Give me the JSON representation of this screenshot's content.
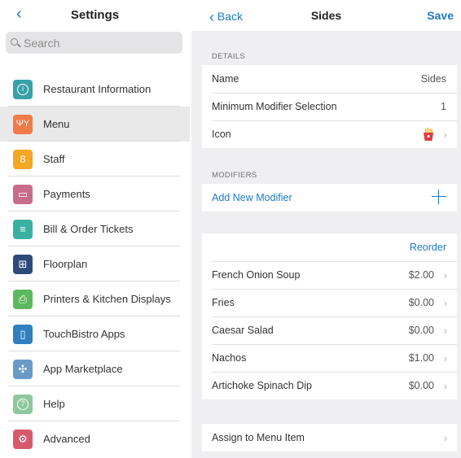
{
  "left": {
    "back_glyph": "‹",
    "title": "Settings",
    "search_placeholder": "Search",
    "items": [
      {
        "label": "Restaurant Information",
        "icon": "info-icon",
        "glyph": "i",
        "color": "#3aa0a8"
      },
      {
        "label": "Menu",
        "icon": "fork-knife-icon",
        "glyph": "ΨΥ",
        "color": "#f07a4a",
        "selected": true
      },
      {
        "label": "Staff",
        "icon": "person-icon",
        "glyph": "8",
        "color": "#f5a623"
      },
      {
        "label": "Payments",
        "icon": "card-icon",
        "glyph": "▭",
        "color": "#c96b8a"
      },
      {
        "label": "Bill & Order Tickets",
        "icon": "receipt-icon",
        "glyph": "≡",
        "color": "#3ab0a0"
      },
      {
        "label": "Floorplan",
        "icon": "floorplan-icon",
        "glyph": "⊞",
        "color": "#2c4a7a"
      },
      {
        "label": "Printers & Kitchen Displays",
        "icon": "printer-icon",
        "glyph": "⎙",
        "color": "#5cb85c"
      },
      {
        "label": "TouchBistro Apps",
        "icon": "tablet-icon",
        "glyph": "▯",
        "color": "#2f7fc1"
      },
      {
        "label": "App Marketplace",
        "icon": "puzzle-icon",
        "glyph": "✣",
        "color": "#6a9ac8"
      },
      {
        "label": "Help",
        "icon": "help-icon",
        "glyph": "?",
        "color": "#8dc89a"
      },
      {
        "label": "Advanced",
        "icon": "gear-icon",
        "glyph": "⚙",
        "color": "#d65a6a"
      }
    ]
  },
  "right": {
    "back_label": "Back",
    "title": "Sides",
    "save_label": "Save",
    "details_header": "DETAILS",
    "details": {
      "name_label": "Name",
      "name_value": "Sides",
      "min_label": "Minimum Modifier Selection",
      "min_value": "1",
      "icon_label": "Icon"
    },
    "modifiers_header": "MODIFIERS",
    "add_modifier_label": "Add New Modifier",
    "reorder_label": "Reorder",
    "modifiers": [
      {
        "name": "French Onion Soup",
        "price": "$2.00"
      },
      {
        "name": "Fries",
        "price": "$0.00"
      },
      {
        "name": "Caesar Salad",
        "price": "$0.00"
      },
      {
        "name": "Nachos",
        "price": "$1.00"
      },
      {
        "name": "Artichoke Spinach Dip",
        "price": "$0.00"
      }
    ],
    "assign_label": "Assign to Menu Item",
    "chevron_glyph": "›"
  },
  "colors": {
    "accent": "#1f7ac6",
    "background": "#efeff2"
  }
}
